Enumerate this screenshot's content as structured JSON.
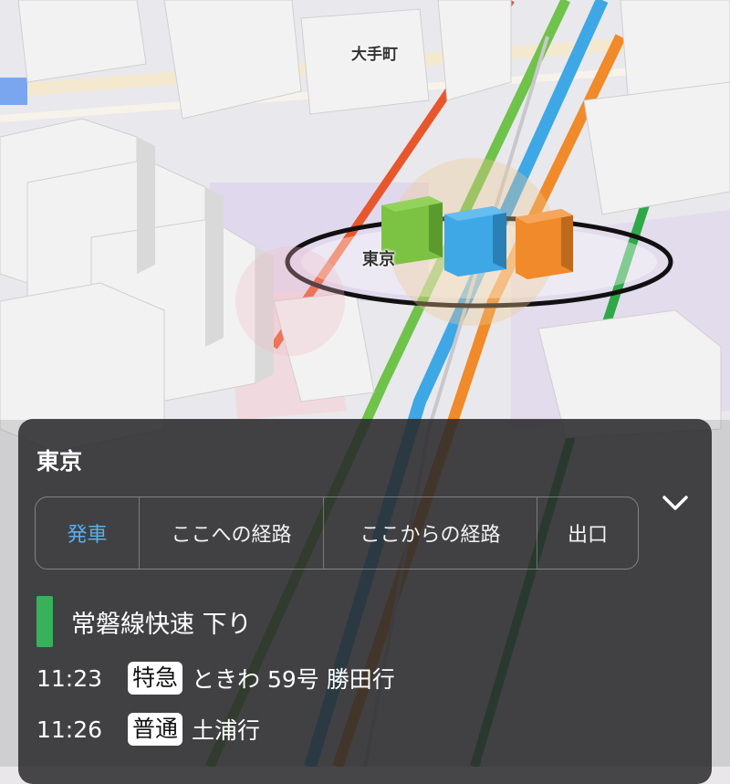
{
  "map": {
    "labels": {
      "otemachi": "大手町",
      "tokyo": "東京"
    },
    "line_colors": [
      "#e8572b",
      "#6fc24a",
      "#3ea7e6",
      "#f08a2a",
      "#2fa84a"
    ]
  },
  "panel": {
    "title": "東京",
    "collapse_icon": "chevron-down-icon",
    "tabs": [
      {
        "label": "発車",
        "active": true
      },
      {
        "label": "ここへの経路",
        "active": false
      },
      {
        "label": "ここからの経路",
        "active": false
      },
      {
        "label": "出口",
        "active": false
      }
    ],
    "line": {
      "name": "常磐線快速 下り",
      "color": "#37b25a"
    },
    "departures": [
      {
        "time": "11:23",
        "type": "特急",
        "destination": "ときわ 59号 勝田行"
      },
      {
        "time": "11:26",
        "type": "普通",
        "destination": "土浦行"
      }
    ]
  }
}
